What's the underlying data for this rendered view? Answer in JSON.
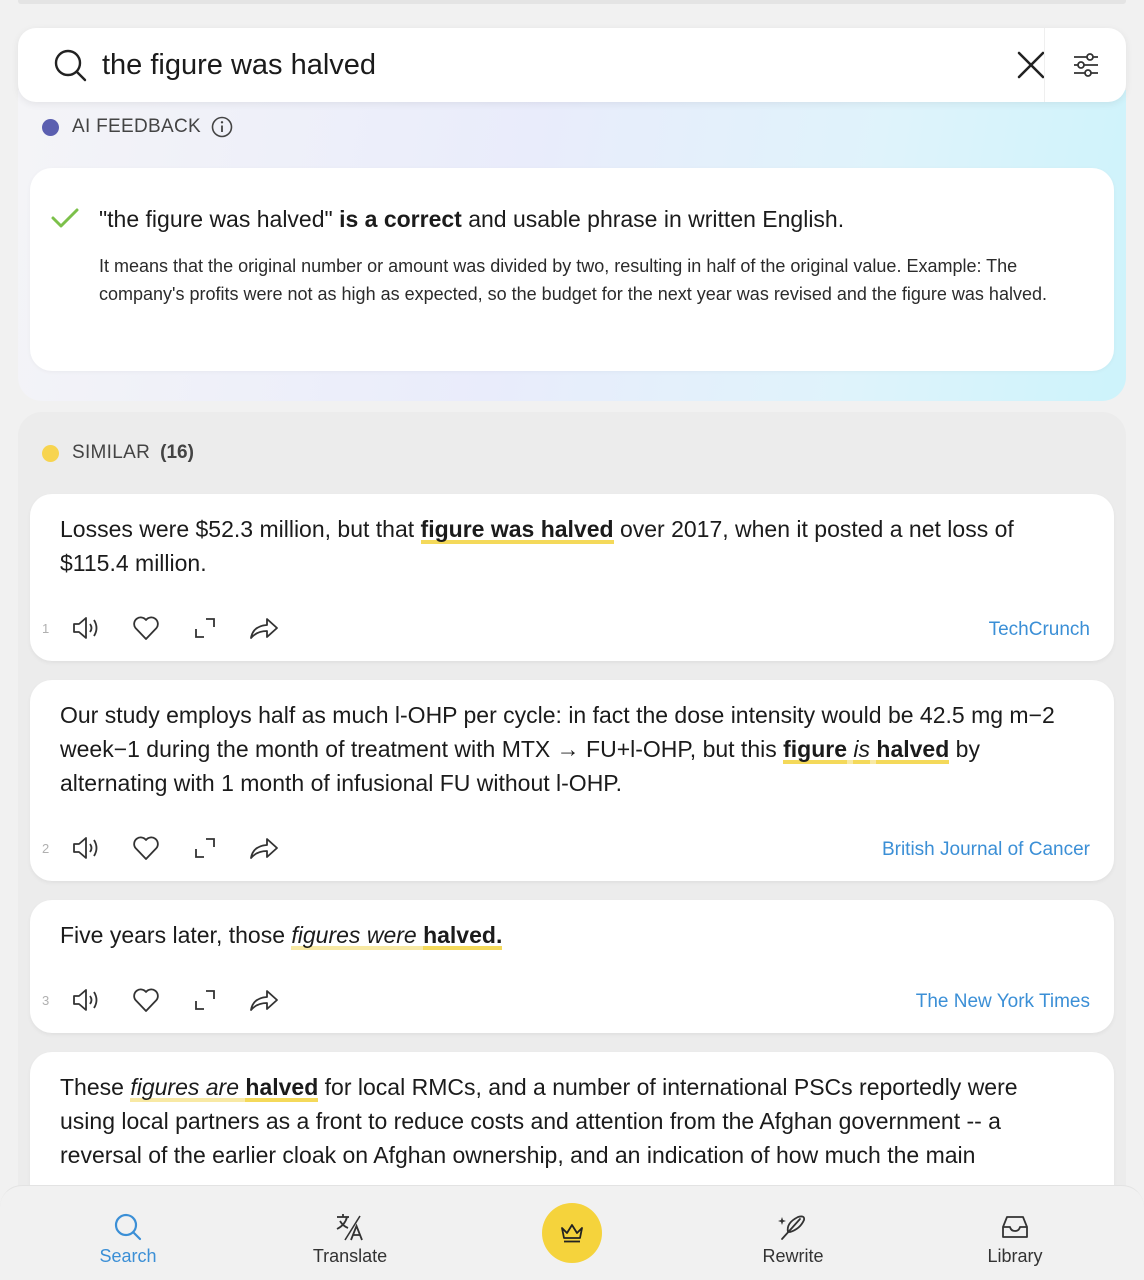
{
  "search": {
    "query": "the figure was halved"
  },
  "ai_feedback": {
    "label": "AI FEEDBACK",
    "headline_quote": "\"the figure was halved\"",
    "headline_bold": "is a correct",
    "headline_rest": "and usable phrase in written English.",
    "explanation": "It means that the original number or amount was divided by two, resulting in half of the original value. Example: The company's profits were not as high as expected, so the budget for the next year was revised and the figure was halved."
  },
  "similar": {
    "label": "SIMILAR",
    "count": "(16)",
    "results": [
      {
        "index": "1",
        "pre": "Losses were $52.3 million, but that ",
        "highlight": "figure was halved",
        "post": " over 2017, when it posted a net loss of $115.4 million.",
        "source": "TechCrunch"
      },
      {
        "index": "2",
        "pre": "Our study employs half as much l-OHP per cycle: in fact the dose intensity would be 42.5 mg m−2 week−1 during the month of treatment with MTX → FU+l-OHP, but this ",
        "highlight_a": "figure",
        "highlight_b": "is",
        "highlight_c": "halved",
        "post": " by alternating with 1 month of infusional FU without l-OHP.",
        "source": "British Journal of Cancer"
      },
      {
        "index": "3",
        "pre": "Five years later, those ",
        "highlight_a": "figures",
        "highlight_b": "were",
        "highlight_c": "halved.",
        "source": "The New York Times"
      },
      {
        "pre": "These ",
        "highlight_a": "figures",
        "highlight_b": "are",
        "highlight_c": "halved",
        "post": " for local RMCs, and a number of international PSCs reportedly were using local partners as a front to reduce costs and attention from the Afghan government -- a reversal of the earlier cloak on Afghan ownership, and an indication of how much the main"
      }
    ]
  },
  "nav": {
    "search": "Search",
    "translate": "Translate",
    "rewrite": "Rewrite",
    "library": "Library"
  },
  "colors": {
    "accent_blue": "#3b8fd6",
    "highlight_yellow": "#f4d95a",
    "ai_dot": "#5b5fb0",
    "similar_dot": "#f7d44f",
    "premium_yellow": "#f5d33c",
    "check_green": "#7cc04a"
  }
}
